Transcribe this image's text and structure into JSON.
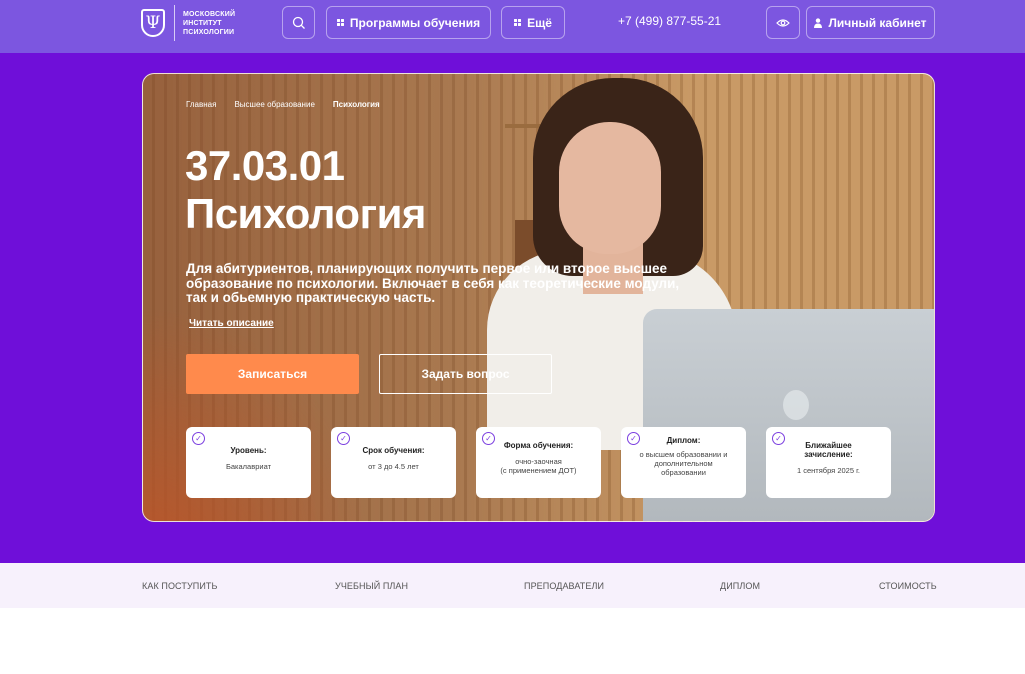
{
  "header": {
    "logo_text": "МОСКОВСКИЙ ИНСТИТУТ ПСИХОЛОГИИ",
    "programs_label": "Программы обучения",
    "more_label": "Ещё",
    "phone": "+7 (499) 877-55-21",
    "cabinet_label": "Личный кабинет"
  },
  "hero": {
    "breadcrumbs": [
      "Главная",
      "Высшее образование",
      "Психология"
    ],
    "code": "37.03.01",
    "title": "Психология",
    "lead": "Для абитуриентов, планирующих получить первое или второе высшее образование по психологии. Включает в себя как теоретические модули, так и обьемную практическую часть.",
    "read_more": "Читать описание",
    "enroll_label": "Записаться",
    "ask_label": "Задать вопрос"
  },
  "facts": [
    {
      "title": "Уровень:",
      "value": "Бакалавриат"
    },
    {
      "title": "Срок обучения:",
      "value": "от 3 до 4.5 лет"
    },
    {
      "title": "Форма обучения:",
      "value": "очно-заочная\n(с применением ДОТ)"
    },
    {
      "title": "Диплом:",
      "value": "о высшем образовании и дополнительном образовании"
    },
    {
      "title": "Ближайшее зачисление:",
      "value": "1 сентября 2025 г."
    }
  ],
  "subnav": [
    "КАК ПОСТУПИТЬ",
    "УЧЕБНЫЙ ПЛАН",
    "ПРЕПОДАВАТЕЛИ",
    "ДИПЛОМ",
    "СТОИМОСТЬ"
  ],
  "colors": {
    "header": "#7c56e0",
    "band": "#6f0fd9",
    "accent": "#ff8a4c"
  }
}
